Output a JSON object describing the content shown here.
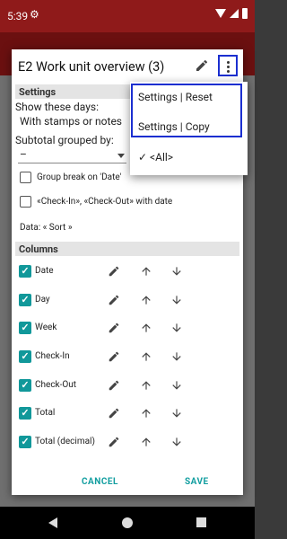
{
  "status_bar": {
    "time": "5:39"
  },
  "dialog": {
    "title": "E2 Work unit overview (3)",
    "settings_section": "Settings",
    "show_days_label": "Show these days:",
    "show_days_value": "With stamps or notes",
    "subtotal_label": "Subtotal grouped by:",
    "subtotal_value": "–",
    "group_break_label": "Group break on 'Date'",
    "checkin_checkout_label": "«Check-In», «Check-Out» with date",
    "data_sort_label": "Data: « Sort »",
    "columns_section": "Columns",
    "columns": [
      {
        "label": "Date",
        "checked": true
      },
      {
        "label": "Day",
        "checked": true
      },
      {
        "label": "Week",
        "checked": true
      },
      {
        "label": "Check-In",
        "checked": true
      },
      {
        "label": "Check-Out",
        "checked": true
      },
      {
        "label": "Total",
        "checked": true
      },
      {
        "label": "Total (decimal)",
        "checked": true
      }
    ],
    "cancel_label": "CANCEL",
    "save_label": "SAVE"
  },
  "popup_menu": {
    "items": [
      "Settings | Reset",
      "Settings | Copy",
      "<All>"
    ],
    "checked_item": "<All>",
    "checkmark": "✓"
  },
  "icons": {
    "status_settings": "gear-icon",
    "overflow": "more-vert-icon",
    "edit": "pencil-icon",
    "move_up": "arrow-up-icon",
    "move_down": "arrow-down-icon"
  },
  "colors": {
    "accent": "#129ea0",
    "status_bar": "#8f1a1a",
    "highlight_box": "#1b2fd0"
  }
}
